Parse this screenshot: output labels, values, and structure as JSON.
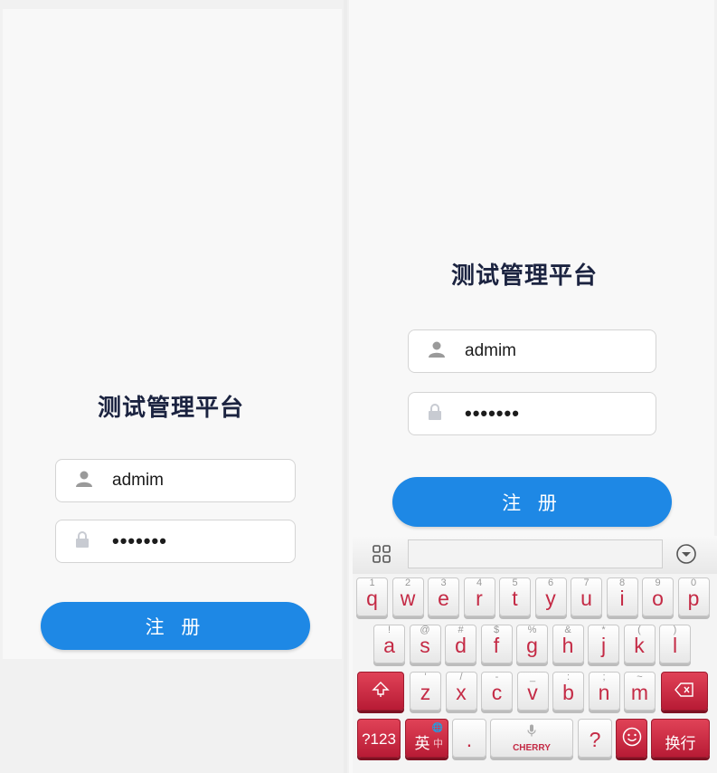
{
  "left": {
    "title": "测试管理平台",
    "username": "admim",
    "password": "•••••••",
    "register": "注 册"
  },
  "right": {
    "title": "测试管理平台",
    "username": "admim",
    "password": "•••••••",
    "register": "注 册"
  },
  "keyboard": {
    "row1": [
      {
        "k": "q",
        "s": "1"
      },
      {
        "k": "w",
        "s": "2"
      },
      {
        "k": "e",
        "s": "3"
      },
      {
        "k": "r",
        "s": "4"
      },
      {
        "k": "t",
        "s": "5"
      },
      {
        "k": "y",
        "s": "6"
      },
      {
        "k": "u",
        "s": "7"
      },
      {
        "k": "i",
        "s": "8"
      },
      {
        "k": "o",
        "s": "9"
      },
      {
        "k": "p",
        "s": "0"
      }
    ],
    "row2": [
      {
        "k": "a",
        "s": "!"
      },
      {
        "k": "s",
        "s": "@"
      },
      {
        "k": "d",
        "s": "#"
      },
      {
        "k": "f",
        "s": "$"
      },
      {
        "k": "g",
        "s": "%"
      },
      {
        "k": "h",
        "s": "&"
      },
      {
        "k": "j",
        "s": "*"
      },
      {
        "k": "k",
        "s": "("
      },
      {
        "k": "l",
        "s": ")"
      }
    ],
    "row3": [
      {
        "k": "z",
        "s": "'"
      },
      {
        "k": "x",
        "s": "/"
      },
      {
        "k": "c",
        "s": "-"
      },
      {
        "k": "v",
        "s": "_"
      },
      {
        "k": "b",
        "s": ":"
      },
      {
        "k": "n",
        "s": ";"
      },
      {
        "k": "m",
        "s": "~"
      }
    ],
    "key_123": "?123",
    "key_lang": "英",
    "key_lang_sub": "中",
    "key_period": ".",
    "key_question": "?",
    "key_enter": "换行",
    "space_brand": "CHERRY",
    "accent": "#c42a45"
  }
}
